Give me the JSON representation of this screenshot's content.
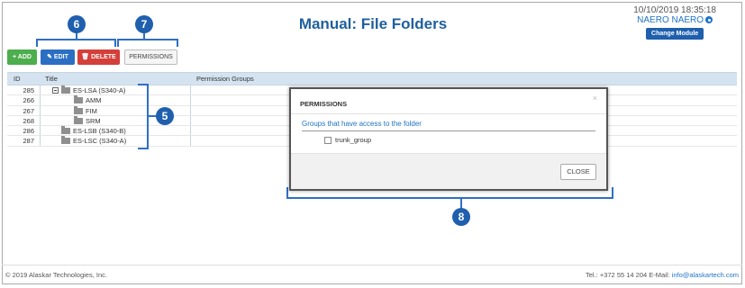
{
  "header": {
    "title": "Manual: File Folders",
    "datetime": "10/10/2019 18:35:18",
    "user": "NAERO NAERO",
    "change_module": "Change Module"
  },
  "toolbar": {
    "add": "+ ADD",
    "edit": "✎ EDIT",
    "delete": "🗑 DELETE",
    "permissions": "PERMISSIONS"
  },
  "grid": {
    "columns": [
      "ID",
      "Title",
      "Permission Groups"
    ],
    "rows": [
      {
        "id": "285",
        "title": "ES-LSA (S340-A)",
        "level": 0,
        "expanded": true
      },
      {
        "id": "266",
        "title": "AMM",
        "level": 1
      },
      {
        "id": "267",
        "title": "FIM",
        "level": 1
      },
      {
        "id": "268",
        "title": "SRM",
        "level": 1
      },
      {
        "id": "286",
        "title": "ES-LSB (S340-B)",
        "level": 0
      },
      {
        "id": "287",
        "title": "ES-LSC (S340-A)",
        "level": 0
      }
    ]
  },
  "dialog": {
    "title": "PERMISSIONS",
    "close_x": "×",
    "group_label": "Groups that have access to the folder",
    "checkbox_label": "trunk_group",
    "close_button": "CLOSE"
  },
  "footer": {
    "copyright": "© 2019 Alaskar Technologies, Inc.",
    "contact_prefix": "Tel.: +372 55 14 204 E-Mail: ",
    "email": "info@alaskartech.com"
  },
  "callouts": {
    "five": "5",
    "six": "6",
    "seven": "7",
    "eight": "8"
  },
  "colors": {
    "accent": "#1f5fae",
    "add": "#4cae4c",
    "edit": "#2b6fc4",
    "delete": "#d43f3a",
    "header_row": "#d4e3ef"
  }
}
